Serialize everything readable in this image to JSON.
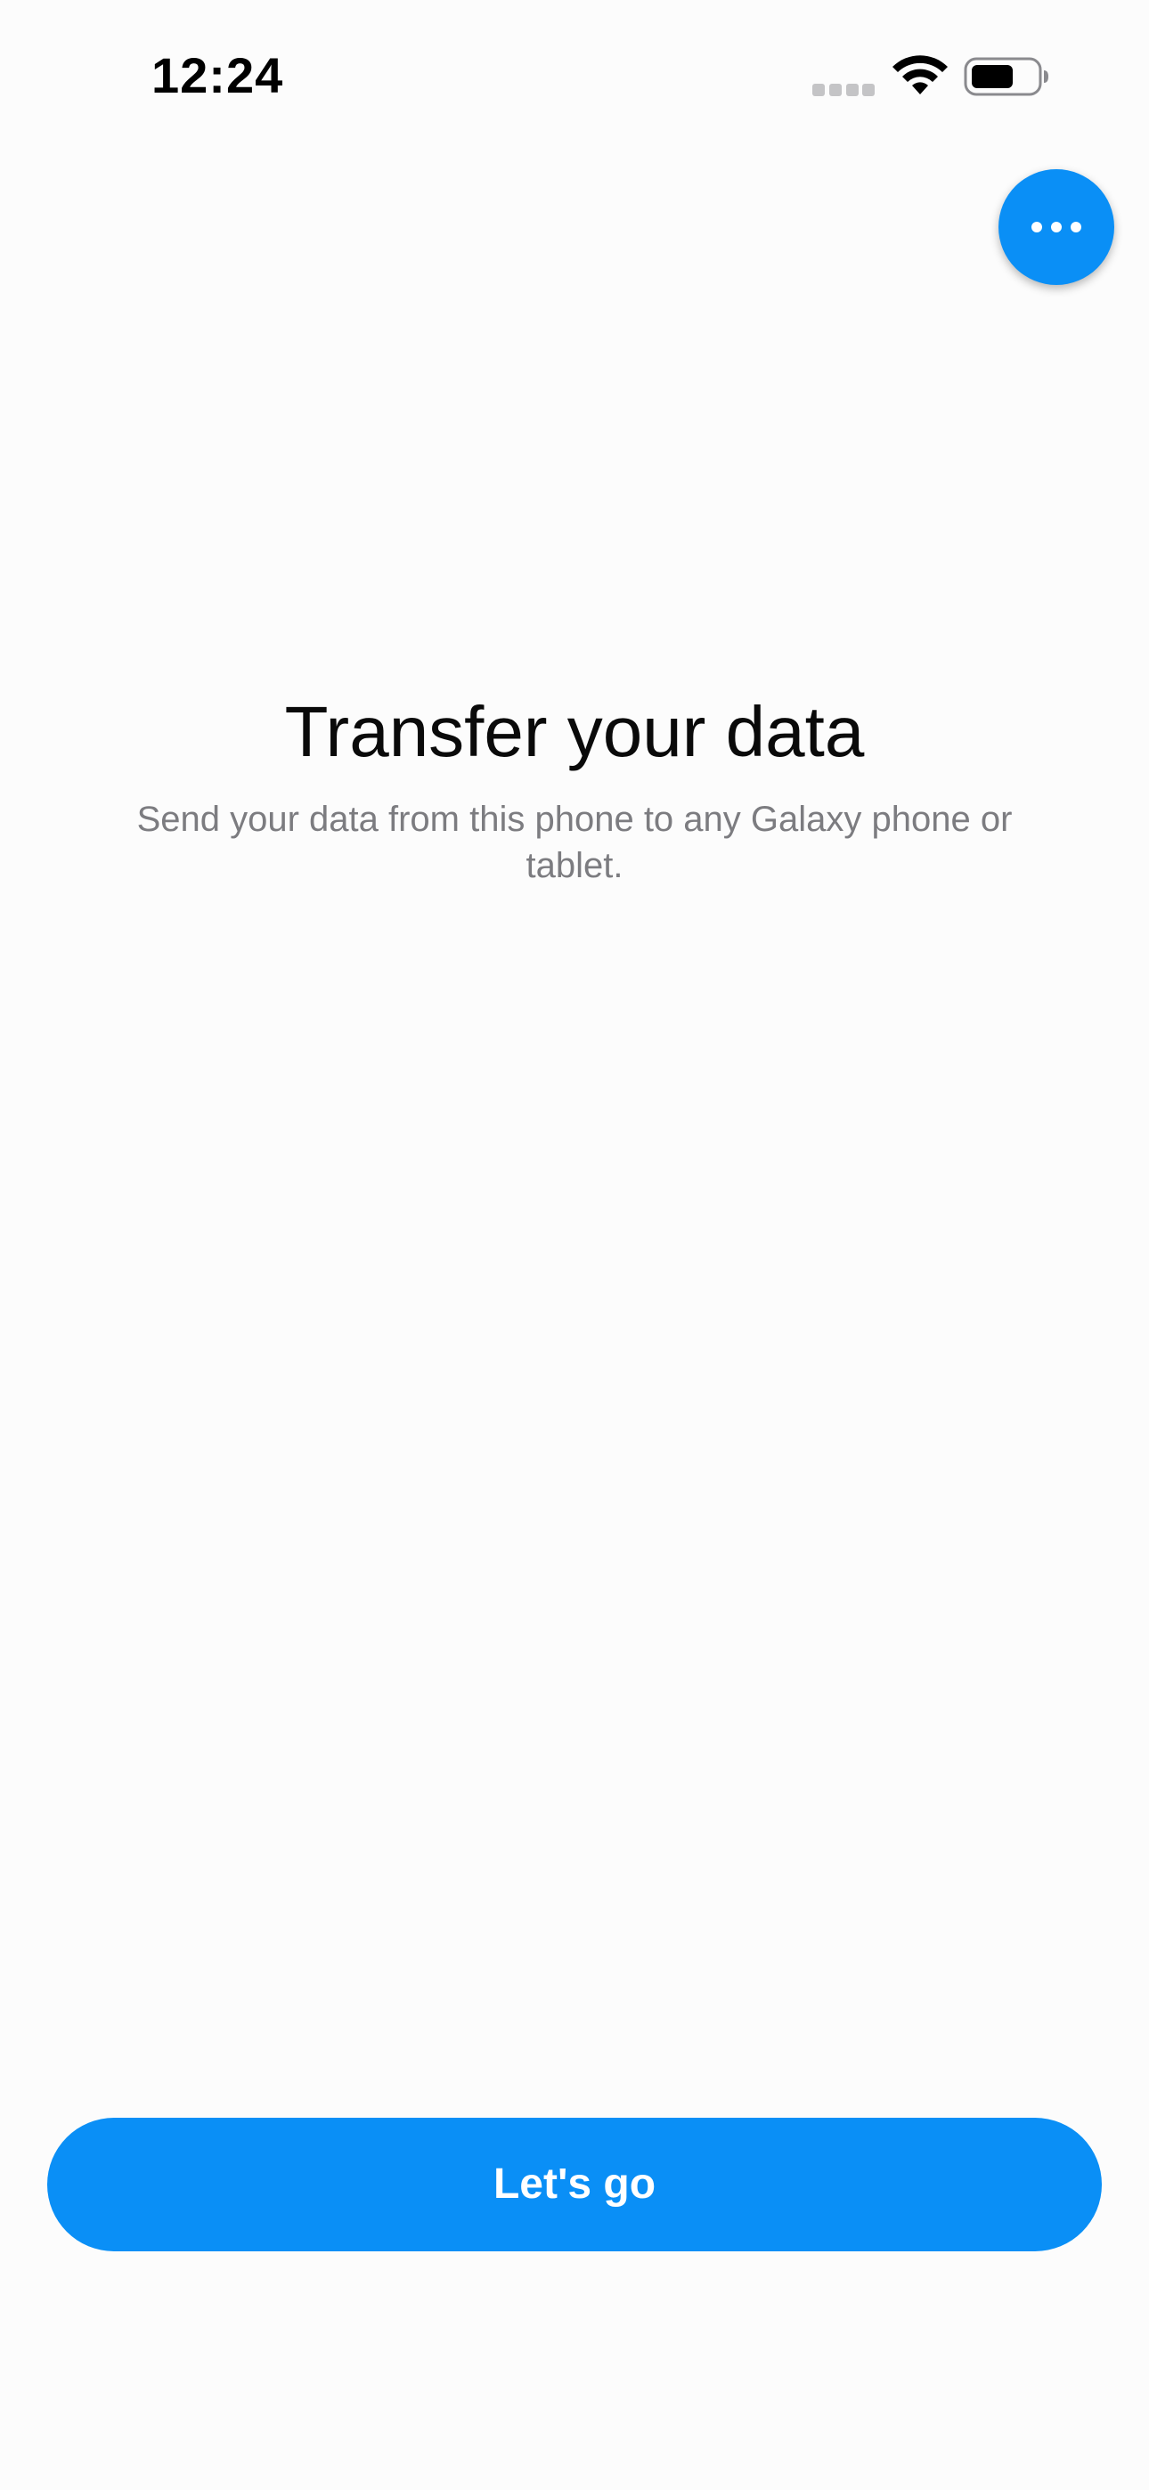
{
  "status_bar": {
    "time": "12:24",
    "icons": [
      "signal-dots-icon",
      "wifi-icon",
      "battery-icon"
    ]
  },
  "menu": {
    "icon": "more-horizontal-icon"
  },
  "main": {
    "title": "Transfer your data",
    "subtitle": "Send your data from this phone to any Galaxy phone or tablet."
  },
  "actions": {
    "primary_label": "Let's go"
  },
  "colors": {
    "accent": "#0a8ff6",
    "background": "#fcfcfc",
    "title": "#0a0a0a",
    "subtitle": "#7c7c80"
  }
}
